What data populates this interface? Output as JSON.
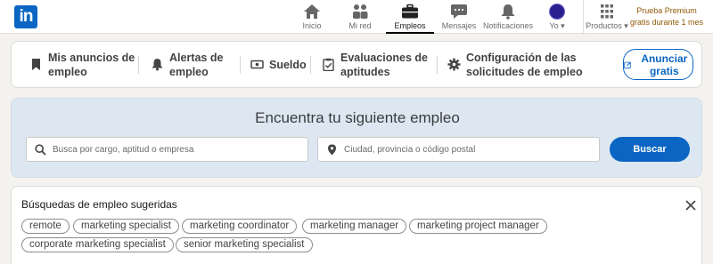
{
  "nav": {
    "logo": "in",
    "items": [
      {
        "label": "Inicio",
        "icon": "home-icon"
      },
      {
        "label": "Mi red",
        "icon": "network-icon"
      },
      {
        "label": "Empleos",
        "icon": "briefcase-icon",
        "active": true
      },
      {
        "label": "Mensajes",
        "icon": "messaging-icon"
      },
      {
        "label": "Notificaciones",
        "icon": "bell-icon"
      },
      {
        "label": "Yo",
        "icon": "avatar"
      },
      {
        "label": "Productos",
        "icon": "grid-icon"
      }
    ],
    "premium": "Prueba Premium gratis durante 1 mes"
  },
  "tabs": {
    "items": [
      {
        "label": "Mis anuncios de empleo",
        "icon": "bookmark-icon"
      },
      {
        "label": "Alertas de empleo",
        "icon": "bell-icon"
      },
      {
        "label": "Sueldo",
        "icon": "money-icon"
      },
      {
        "label": "Evaluaciones de aptitudes",
        "icon": "clipboard-check-icon"
      },
      {
        "label": "Configuración de las solicitudes de empleo",
        "icon": "gear-icon"
      }
    ],
    "post_job": "Anunciar gratis"
  },
  "search": {
    "title": "Encuentra tu siguiente empleo",
    "keyword_placeholder": "Busca por cargo, aptitud o empresa",
    "location_placeholder": "Ciudad, provincia o código postal",
    "button": "Buscar"
  },
  "suggestions": {
    "title": "Búsquedas de empleo sugeridas",
    "pills": [
      "remote",
      "marketing specialist",
      "marketing coordinator",
      "marketing manager",
      "marketing project manager",
      "corporate marketing specialist",
      "senior marketing specialist"
    ]
  },
  "colors": {
    "brand": "#0a66c2",
    "hero_bg": "#dde7f1",
    "premium_text": "#915907"
  }
}
